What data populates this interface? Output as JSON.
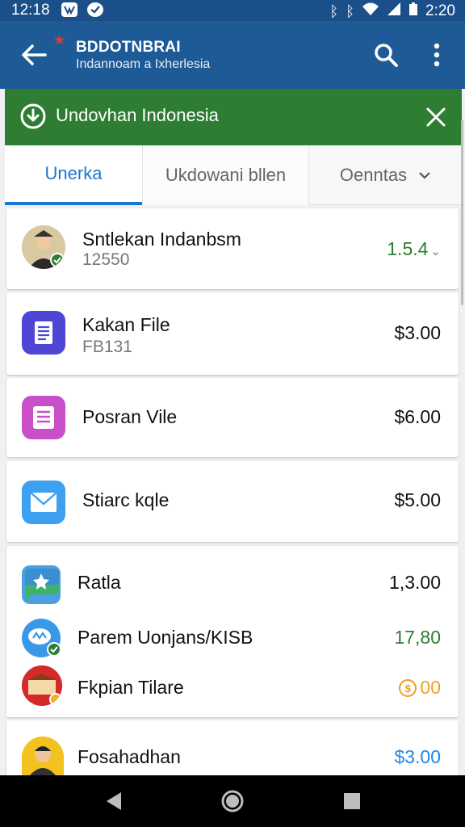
{
  "status_bar": {
    "time_left": "12:18",
    "time_right": "2:20"
  },
  "app_bar": {
    "title": "BDDOTNBRAI",
    "subtitle": "Indannoam a Ixherlesia"
  },
  "banner": {
    "text": "Undovhan Indonesia"
  },
  "tabs": [
    {
      "label": "Unerka",
      "active": true
    },
    {
      "label": "Ukdowani bllen",
      "active": false
    },
    {
      "label": "Oenntas",
      "active": false
    }
  ],
  "items": [
    {
      "name": "Sntlekan Indanbsm",
      "subtitle": "12550",
      "price": "1.5.4",
      "price_color": "green",
      "icon": "avatar-icon"
    },
    {
      "name": "Kakan File",
      "subtitle": "FB131",
      "price": "$3.00",
      "price_color": "default",
      "icon": "document-icon"
    },
    {
      "name": "Posran Vile",
      "subtitle": "",
      "price": "$6.00",
      "price_color": "default",
      "icon": "list-document-icon"
    },
    {
      "name": "Stiarc kqle",
      "subtitle": "",
      "price": "$5.00",
      "price_color": "default",
      "icon": "mail-icon"
    },
    {
      "name": "Ratla",
      "subtitle": "",
      "price": "1,3.00",
      "price_color": "default",
      "icon": "chat-bubble-icon"
    },
    {
      "name": "Parem Uonjans/KISB",
      "subtitle": "",
      "price": "17,80",
      "price_color": "green",
      "icon": "message-icon"
    },
    {
      "name": "Fkpian Tilare",
      "subtitle": "",
      "price": "00",
      "price_color": "orange",
      "icon": "flag-avatar-icon"
    },
    {
      "name": "Fosahadhan",
      "subtitle": "",
      "price": "$3.00",
      "price_color": "blue",
      "icon": "avatar-icon"
    }
  ],
  "colors": {
    "app_bar": "#1e5a96",
    "banner": "#2e7d32",
    "accent": "#1976d2",
    "price_green": "#2e7d32",
    "price_blue": "#1e88e5",
    "price_orange": "#f0a020"
  }
}
